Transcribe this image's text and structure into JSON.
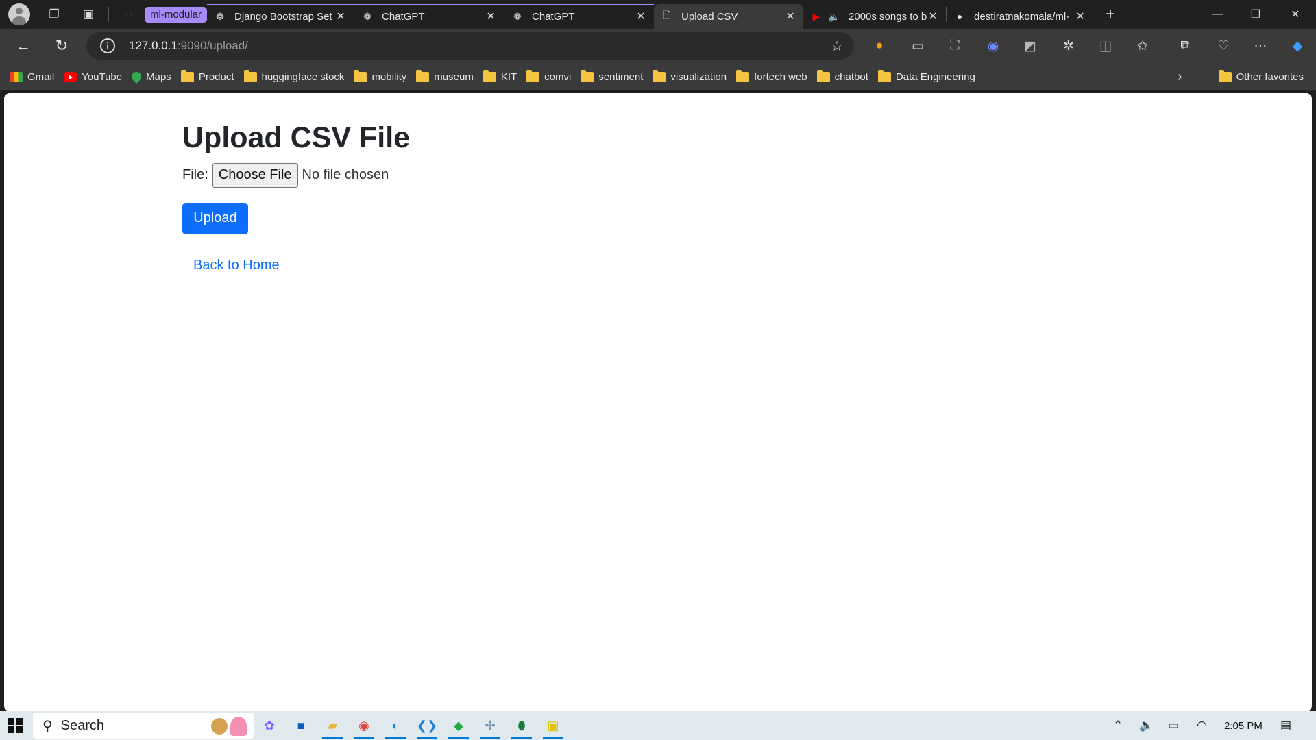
{
  "browser": {
    "tab_group_label": "ml-modular",
    "tabs": [
      {
        "title": "Django Bootstrap Set",
        "icon": "chatgpt-icon"
      },
      {
        "title": "ChatGPT",
        "icon": "chatgpt-icon"
      },
      {
        "title": "ChatGPT",
        "icon": "chatgpt-icon"
      },
      {
        "title": "Upload CSV",
        "icon": "page-icon",
        "active": true
      },
      {
        "title": "2000s songs to b",
        "icon": "youtube-icon"
      },
      {
        "title": "destiratnakomala/ml-",
        "icon": "github-icon"
      }
    ],
    "url_host": "127.0.0.1",
    "url_rest": ":9090/upload/"
  },
  "bookmarks": [
    "Gmail",
    "YouTube",
    "Maps",
    "Product",
    "huggingface stock",
    "mobility",
    "museum",
    "KIT",
    "comvi",
    "sentiment",
    "visualization",
    "fortech web",
    "chatbot",
    "Data Engineering"
  ],
  "other_favorites": "Other favorites",
  "page": {
    "title": "Upload CSV File",
    "file_label": "File:",
    "choose_file": "Choose File",
    "no_file": "No file chosen",
    "upload_button": "Upload",
    "back_link": "Back to Home"
  },
  "taskbar": {
    "search_label": "Search",
    "time": "2:05 PM"
  },
  "colors": {
    "primary": "#0d6efd",
    "tab_group": "#a78bfa",
    "taskbar": "#dfe9ee"
  }
}
